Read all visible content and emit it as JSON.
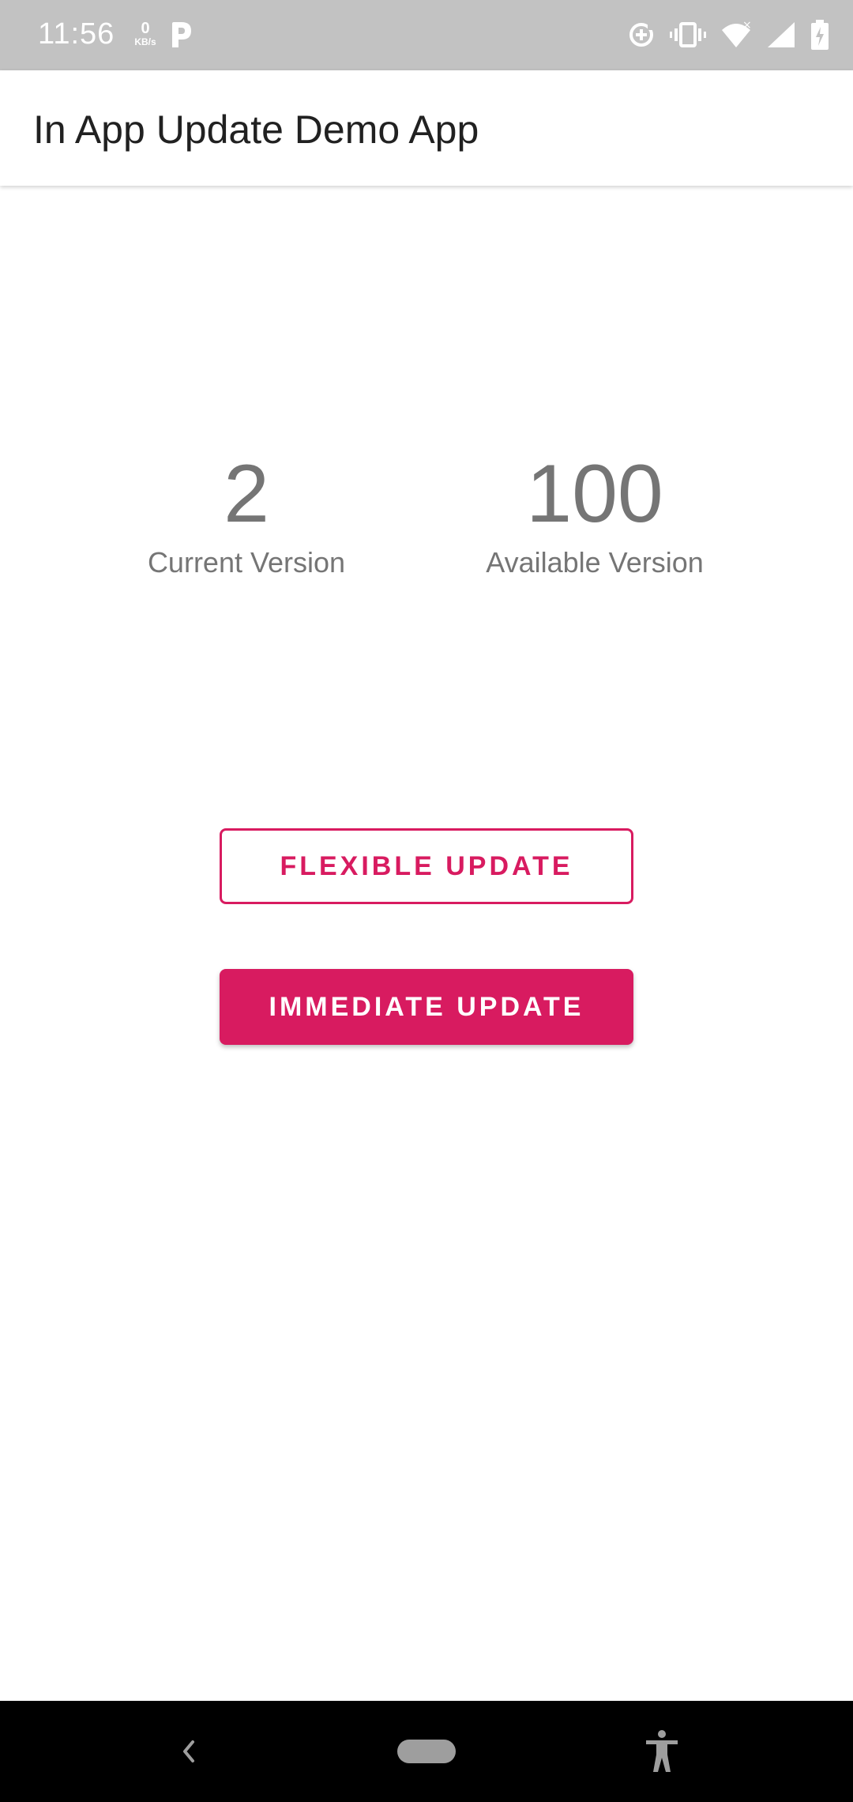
{
  "status_bar": {
    "time": "11:56",
    "net_speed_value": "0",
    "net_speed_unit": "KB/s",
    "icons": [
      "p-app-icon",
      "data-saver-icon",
      "vibrate-icon",
      "wifi-icon",
      "signal-icon",
      "battery-charging-icon"
    ]
  },
  "app_bar": {
    "title": "In App Update Demo App"
  },
  "versions": {
    "current": {
      "number": "2",
      "label": "Current Version"
    },
    "available": {
      "number": "100",
      "label": "Available Version"
    }
  },
  "buttons": {
    "flexible_label": "FLEXIBLE UPDATE",
    "immediate_label": "IMMEDIATE UPDATE"
  },
  "nav_bar": {
    "icons": [
      "back-icon",
      "home-pill-icon",
      "accessibility-icon"
    ]
  },
  "colors": {
    "accent": "#d81b60",
    "status_bar": "#c2c2c2",
    "text_secondary": "#757575",
    "title_text": "#212121",
    "nav_bar": "#000000"
  }
}
